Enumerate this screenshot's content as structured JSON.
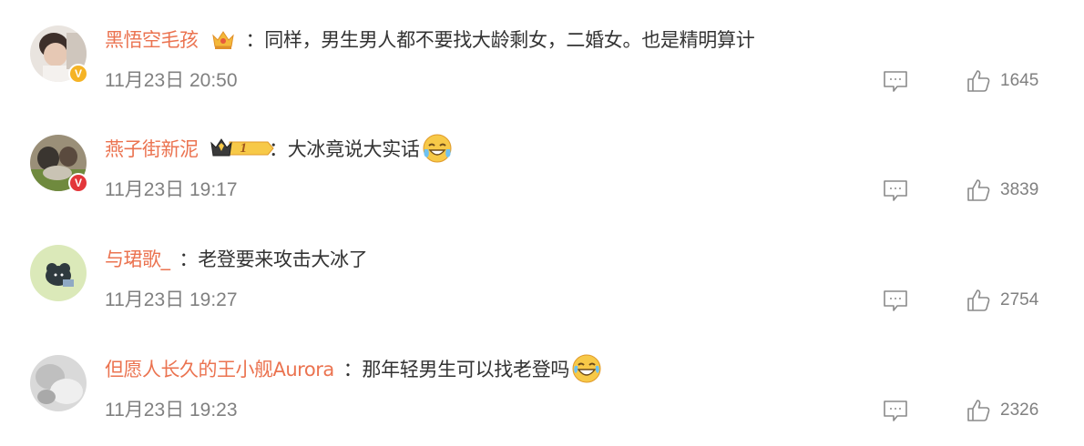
{
  "comments": [
    {
      "username": "黑悟空毛孩",
      "text": "：同样，男生男人都不要找大龄剩女，二婚女。也是精明算计",
      "time": "11月23日 20:50",
      "likes": "1645",
      "badge": "crown-badge",
      "verified": "yellow-v",
      "emoji": "",
      "colors": {
        "verify": "#f5b325"
      }
    },
    {
      "username": "燕子街新泥",
      "text": "：大冰竟说大实话",
      "time": "11月23日 19:17",
      "likes": "3839",
      "badge": "vip-level-1-badge",
      "badge_level": "1",
      "verified": "red-v",
      "emoji": "cry-laugh-emoji",
      "colors": {
        "verify": "#e3363a"
      }
    },
    {
      "username": "与珺歌_",
      "text": "：老登要来攻击大冰了",
      "time": "11月23日 19:27",
      "likes": "2754",
      "badge": "",
      "verified": "",
      "emoji": ""
    },
    {
      "username": "但愿人长久的王小舰Aurora",
      "text": "：那年轻男生可以找老登吗",
      "time": "11月23日 19:23",
      "likes": "2326",
      "badge": "",
      "verified": "",
      "emoji": "laugh-tears-emoji"
    }
  ],
  "colors": {
    "username": "#eb7350",
    "text": "#333333",
    "meta": "#808080",
    "icon": "#8a8a8a"
  }
}
